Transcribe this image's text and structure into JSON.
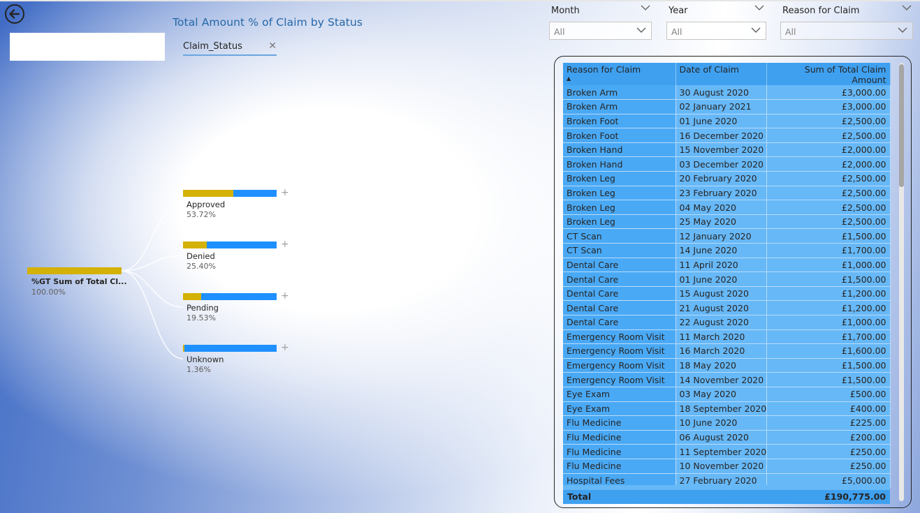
{
  "visual": {
    "title": "Total Amount % of Claim by Status",
    "field_chip": "Claim_Status",
    "root": {
      "label": "%GT Sum of Total Cl...",
      "pct": "100.00%",
      "value": 100.0
    },
    "nodes": [
      {
        "label": "Approved",
        "pct": "53.72%",
        "value": 53.72
      },
      {
        "label": "Denied",
        "pct": "25.40%",
        "value": 25.4
      },
      {
        "label": "Pending",
        "pct": "19.53%",
        "value": 19.53
      },
      {
        "label": "Unknown",
        "pct": "1.36%",
        "value": 1.36
      }
    ],
    "colors": {
      "bar": "#d4b106",
      "remainder": "#1e90ff",
      "title": "#2567a8"
    }
  },
  "slicers": {
    "month": {
      "label": "Month",
      "value": "All"
    },
    "year": {
      "label": "Year",
      "value": "All"
    },
    "reason": {
      "label": "Reason for Claim",
      "value": "All"
    }
  },
  "table": {
    "headers": [
      "Reason for Claim",
      "Date of Claim",
      "Sum of Total Claim Amount"
    ],
    "rows": [
      [
        "Broken Arm",
        "30 August 2020",
        "£3,000.00"
      ],
      [
        "Broken Arm",
        "02 January 2021",
        "£3,000.00"
      ],
      [
        "Broken Foot",
        "01 June 2020",
        "£2,500.00"
      ],
      [
        "Broken Foot",
        "16 December 2020",
        "£2,500.00"
      ],
      [
        "Broken Hand",
        "15 November 2020",
        "£2,000.00"
      ],
      [
        "Broken Hand",
        "03 December 2020",
        "£2,000.00"
      ],
      [
        "Broken Leg",
        "20 February 2020",
        "£2,500.00"
      ],
      [
        "Broken Leg",
        "23 February 2020",
        "£2,500.00"
      ],
      [
        "Broken Leg",
        "04 May 2020",
        "£2,500.00"
      ],
      [
        "Broken Leg",
        "25 May 2020",
        "£2,500.00"
      ],
      [
        "CT Scan",
        "12 January 2020",
        "£1,500.00"
      ],
      [
        "CT Scan",
        "14 June 2020",
        "£1,700.00"
      ],
      [
        "Dental Care",
        "11 April 2020",
        "£1,000.00"
      ],
      [
        "Dental Care",
        "01 June 2020",
        "£1,500.00"
      ],
      [
        "Dental Care",
        "15 August 2020",
        "£1,200.00"
      ],
      [
        "Dental Care",
        "21 August 2020",
        "£1,200.00"
      ],
      [
        "Dental Care",
        "22 August 2020",
        "£1,000.00"
      ],
      [
        "Emergency Room Visit",
        "11 March 2020",
        "£1,700.00"
      ],
      [
        "Emergency Room Visit",
        "16 March 2020",
        "£1,600.00"
      ],
      [
        "Emergency Room Visit",
        "18 May 2020",
        "£1,500.00"
      ],
      [
        "Emergency Room Visit",
        "14 November 2020",
        "£1,500.00"
      ],
      [
        "Eye Exam",
        "03 May 2020",
        "£500.00"
      ],
      [
        "Eye Exam",
        "18 September 2020",
        "£400.00"
      ],
      [
        "Flu Medicine",
        "10 June 2020",
        "£225.00"
      ],
      [
        "Flu Medicine",
        "06 August 2020",
        "£200.00"
      ],
      [
        "Flu Medicine",
        "11 September 2020",
        "£250.00"
      ],
      [
        "Flu Medicine",
        "10 November 2020",
        "£250.00"
      ],
      [
        "Hospital Fees",
        "27 February 2020",
        "£5,000.00"
      ]
    ],
    "total_label": "Total",
    "total_value": "£190,775.00",
    "sorted_column": "Reason for Claim",
    "sort_direction": "ascending"
  },
  "icons": {
    "back": "back-arrow-icon",
    "chevron": "chevron-down-icon",
    "close": "close-icon",
    "expand": "plus-icon"
  }
}
